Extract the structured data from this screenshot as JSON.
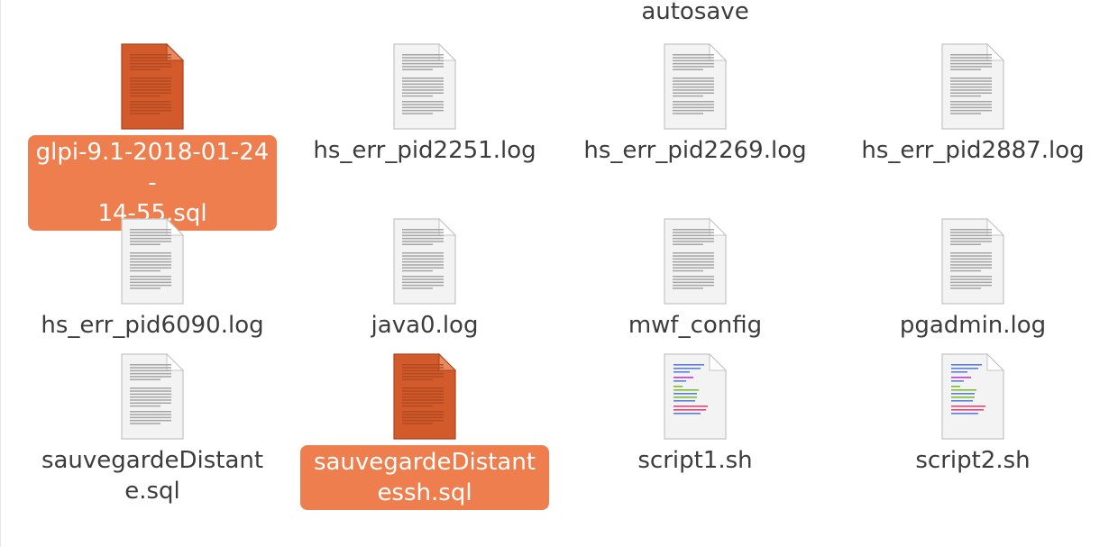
{
  "partial_folder": {
    "label": "autosave"
  },
  "files": [
    {
      "name": "glpi-9.1-2018-01-24-14-55.sql",
      "line1": "glpi-9.1-2018-01-24-",
      "line2": "14-55.sql",
      "type": "sql",
      "selected": true,
      "icon": "orange-text-document-icon"
    },
    {
      "name": "hs_err_pid2251.log",
      "type": "log",
      "selected": false,
      "icon": "text-document-icon"
    },
    {
      "name": "hs_err_pid2269.log",
      "type": "log",
      "selected": false,
      "icon": "text-document-icon"
    },
    {
      "name": "hs_err_pid2887.log",
      "type": "log",
      "selected": false,
      "icon": "text-document-icon"
    },
    {
      "name": "hs_err_pid6090.log",
      "type": "log",
      "selected": false,
      "icon": "text-document-icon"
    },
    {
      "name": "java0.log",
      "type": "log",
      "selected": false,
      "icon": "text-document-icon"
    },
    {
      "name": "mwf_config",
      "type": "text",
      "selected": false,
      "icon": "text-document-icon"
    },
    {
      "name": "pgadmin.log",
      "type": "log",
      "selected": false,
      "icon": "text-document-icon"
    },
    {
      "name": "sauvegardeDistante.sql",
      "line1": "sauvegardeDistant",
      "line2": "e.sql",
      "type": "sql",
      "selected": false,
      "icon": "text-document-icon"
    },
    {
      "name": "sauvegardeDistantessh.sql",
      "line1": "sauvegardeDistant",
      "line2": "essh.sql",
      "type": "sql",
      "selected": true,
      "icon": "orange-text-document-icon"
    },
    {
      "name": "script1.sh",
      "type": "script",
      "selected": false,
      "icon": "shell-script-icon"
    },
    {
      "name": "script2.sh",
      "type": "script",
      "selected": false,
      "icon": "shell-script-icon"
    }
  ],
  "colors": {
    "selection": "#ef7e4f",
    "selected_icon": "#d35a2a",
    "text": "#3c3c3c"
  }
}
